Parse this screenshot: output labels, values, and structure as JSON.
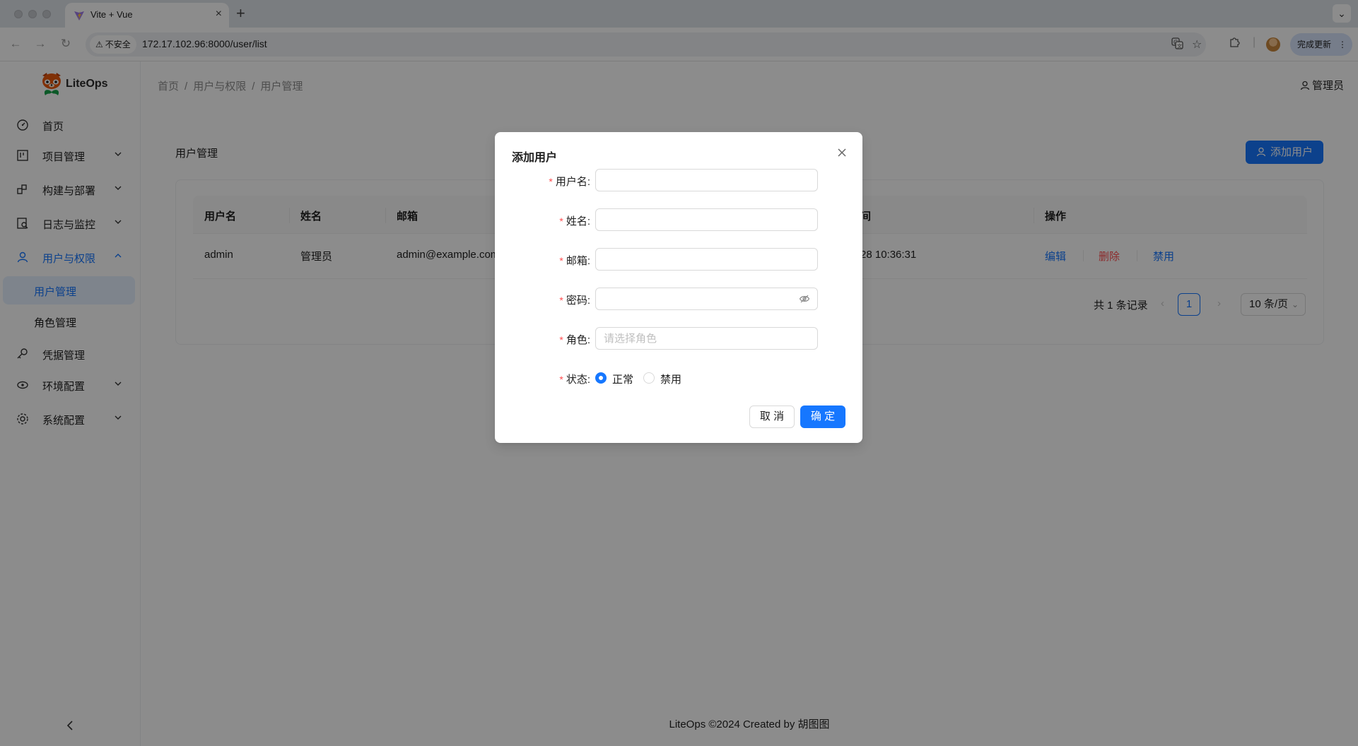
{
  "browser": {
    "tab_title": "Vite + Vue",
    "security_label": "不安全",
    "url": "172.17.102.96:8000/user/list",
    "update_label": "完成更新"
  },
  "app": {
    "logo_text": "LiteOps",
    "user_name": "管理员",
    "breadcrumb": [
      "首页",
      "用户与权限",
      "用户管理"
    ],
    "footer": "LiteOps ©2024 Created by 胡图图"
  },
  "sidebar": {
    "items": [
      {
        "label": "首页",
        "icon": "dashboard-icon"
      },
      {
        "label": "项目管理",
        "icon": "project-icon"
      },
      {
        "label": "构建与部署",
        "icon": "build-icon"
      },
      {
        "label": "日志与监控",
        "icon": "log-icon"
      },
      {
        "label": "用户与权限",
        "icon": "user-icon"
      },
      {
        "label": "凭据管理",
        "icon": "key-icon"
      },
      {
        "label": "环境配置",
        "icon": "environment-icon"
      },
      {
        "label": "系统配置",
        "icon": "settings-icon"
      }
    ],
    "subitems": [
      {
        "label": "用户管理"
      },
      {
        "label": "角色管理"
      }
    ]
  },
  "page": {
    "title": "用户管理",
    "add_button": "添加用户",
    "columns": [
      "用户名",
      "姓名",
      "邮箱",
      "间",
      "操作"
    ],
    "rows": [
      {
        "username": "admin",
        "name": "管理员",
        "email": "admin@example.com",
        "time": "28 10:36:31",
        "actions": [
          "编辑",
          "删除",
          "禁用"
        ]
      }
    ],
    "pager": {
      "total": "共 1 条记录",
      "current": "1",
      "page_size": "10 条/页"
    }
  },
  "modal": {
    "title": "添加用户",
    "fields": {
      "username": {
        "label": "用户名",
        "value": "",
        "placeholder": ""
      },
      "name": {
        "label": "姓名",
        "value": "",
        "placeholder": ""
      },
      "email": {
        "label": "邮箱",
        "value": "",
        "placeholder": ""
      },
      "password": {
        "label": "密码",
        "value": "",
        "placeholder": ""
      },
      "role": {
        "label": "角色",
        "value": "",
        "placeholder": "请选择角色"
      },
      "status": {
        "label": "状态",
        "options": [
          "正常",
          "禁用"
        ],
        "selected": "正常"
      }
    },
    "cancel": "取 消",
    "ok": "确 定"
  },
  "colors": {
    "accent": "#1677ff",
    "danger": "#ff4d4f",
    "mask": "rgba(0,0,0,0.45)"
  }
}
